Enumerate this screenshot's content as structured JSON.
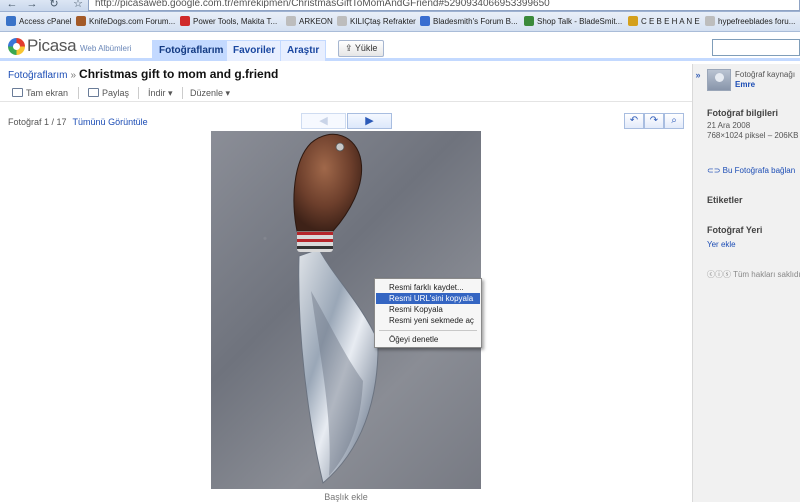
{
  "browser": {
    "url": "http://picasaweb.google.com.tr/emrekipmen/ChristmasGiftToMomAndGFriend#5290934066953399650",
    "bookmarks": [
      {
        "label": "Access cPanel",
        "color": "#3a73c8"
      },
      {
        "label": "KnifeDogs.com Forum...",
        "color": "#a35a28"
      },
      {
        "label": "Power Tools, Makita T...",
        "color": "#d02a2a"
      },
      {
        "label": "ARKEON",
        "color": "#bdbdbd"
      },
      {
        "label": "KILIÇtaş Refrakter",
        "color": "#bdbdbd"
      },
      {
        "label": "Bladesmith's Forum B...",
        "color": "#3a6ed0"
      },
      {
        "label": "Shop Talk - BladeSmit...",
        "color": "#3b8a3b"
      },
      {
        "label": "C E B E H A N E",
        "color": "#d4a01c"
      },
      {
        "label": "hypefreeblades foru...",
        "color": "#bdbdbd"
      }
    ]
  },
  "header": {
    "logo_text": "Picasa",
    "logo_subtitle": "Web Albümleri",
    "tabs": [
      "Fotoğraflarım",
      "Favoriler",
      "Araştır"
    ],
    "upload_label": "Yükle"
  },
  "breadcrumb": {
    "parent": "Fotoğraflarım",
    "separator": "»",
    "title": "Christmas gift to mom and g.friend"
  },
  "toolbar": {
    "fullscreen": "Tam ekran",
    "share": "Paylaş",
    "download": "İndir",
    "edit": "Düzenle"
  },
  "photo_nav": {
    "counter": "Fotoğraf 1 / 17",
    "view_all": "Tümünü Görüntüle",
    "prev": "◀",
    "next": "▶"
  },
  "photo": {
    "caption_placeholder": "Başlık ekle"
  },
  "context_menu": {
    "items": [
      "Resmi farklı kaydet...",
      "Resmi URL'sini kopyala",
      "Resmi Kopyala",
      "Resmi yeni sekmede aç",
      "Öğeyi denetle"
    ],
    "highlighted_index": 1
  },
  "sidebar": {
    "collapse": "»",
    "owner_label": "Fotoğraf kaynağı",
    "owner_name": "Emre",
    "info_heading": "Fotoğraf bilgileri",
    "date": "21 Ara 2008",
    "dimensions": "768×1024 piksel – 206KB",
    "link_label": "Bu Fotoğrafa bağlan",
    "tags_heading": "Etiketler",
    "place_heading": "Fotoğraf Yeri",
    "place_link": "Yer ekle",
    "rights": "Tüm hakları saklıdır"
  }
}
